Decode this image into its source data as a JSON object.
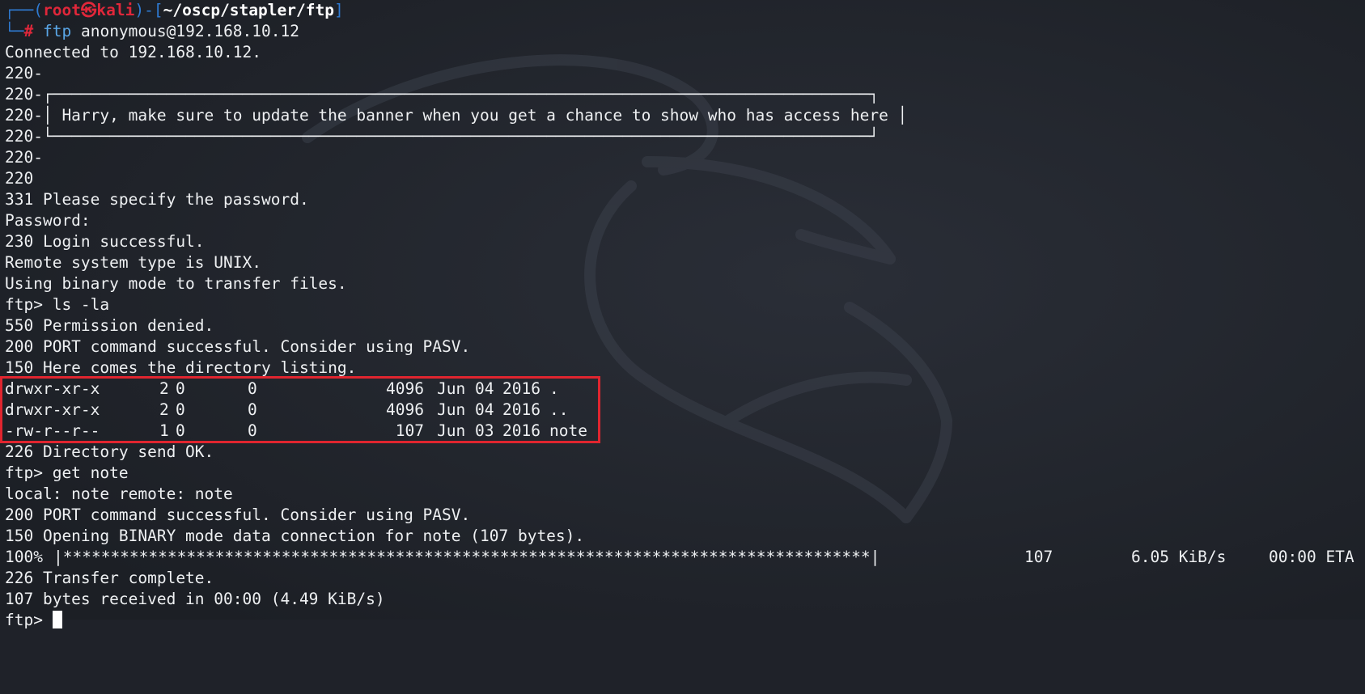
{
  "prompt": {
    "bracket_open": "┌──(",
    "user": "root㉿kali",
    "bracket_mid": ")-[",
    "path": "~/oscp/stapler/ftp",
    "bracket_close": "]",
    "corner": "└─",
    "hash": "#",
    "command": "ftp",
    "args": "anonymous@192.168.10.12"
  },
  "output_lines_a": [
    "Connected to 192.168.10.12.",
    "220-",
    "220-┌──────────────────────────────────────────────────────────────────────────────────────┐",
    "220-│ Harry, make sure to update the banner when you get a chance to show who has access here │",
    "220-└──────────────────────────────────────────────────────────────────────────────────────┘",
    "220-",
    "220",
    "331 Please specify the password.",
    "Password:",
    "230 Login successful.",
    "Remote system type is UNIX.",
    "Using binary mode to transfer files.",
    "ftp> ls -la",
    "550 Permission denied.",
    "200 PORT command successful. Consider using PASV.",
    "150 Here comes the directory listing."
  ],
  "listing": [
    {
      "perm": "drwxr-xr-x",
      "links": "2",
      "owner": "0",
      "group": "0",
      "size": "4096",
      "date": "Jun 04",
      "year": "2016",
      "name": "."
    },
    {
      "perm": "drwxr-xr-x",
      "links": "2",
      "owner": "0",
      "group": "0",
      "size": "4096",
      "date": "Jun 04",
      "year": "2016",
      "name": ".."
    },
    {
      "perm": "-rw-r--r--",
      "links": "1",
      "owner": "0",
      "group": "0",
      "size": "107",
      "date": "Jun 03",
      "year": "2016",
      "name": "note"
    }
  ],
  "output_lines_b": [
    "226 Directory send OK.",
    "ftp> get note",
    "local: note remote: note",
    "200 PORT command successful. Consider using PASV.",
    "150 Opening BINARY mode data connection for note (107 bytes)."
  ],
  "progress": {
    "percent": "100%",
    "bar": "|*************************************************************************************|",
    "bytes": "107",
    "rate": "6.05 KiB/s",
    "eta": "00:00 ETA"
  },
  "output_lines_c": [
    "226 Transfer complete.",
    "107 bytes received in 00:00 (4.49 KiB/s)"
  ],
  "final_prompt": "ftp> ",
  "colors": {
    "background": "#1f2229",
    "prompt_blue": "#2f7bd3",
    "prompt_red": "#e0273a",
    "highlight_box": "#e0252f"
  }
}
